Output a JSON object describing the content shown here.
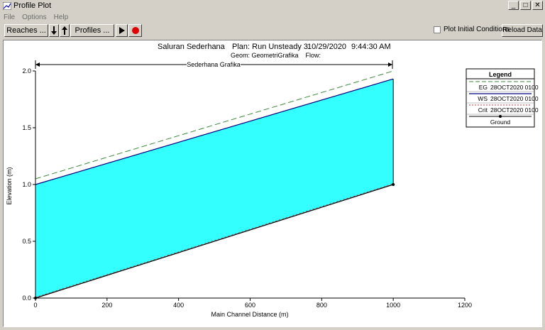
{
  "window": {
    "title": "Profile Plot",
    "min": "_",
    "max": "□",
    "close": "✕"
  },
  "menu": [
    "File",
    "Options",
    "Help"
  ],
  "toolbar": {
    "reaches": "Reaches ...",
    "profiles": "Profiles ...",
    "plot_initial_label": "Plot Initial Conditions",
    "plot_initial_checked": false,
    "reload": "Reload Data"
  },
  "plot": {
    "title_river": "Saluran Sederhana",
    "title_plan": "Plan: Run Unsteady 3",
    "title_date": "10/29/2020",
    "title_time": "9:44:30 AM",
    "geom_line": "Geom: GeometriGrafika    Flow:",
    "reach_label": "Sederhana Grafika",
    "xlabel": "Main Channel Distance (m)",
    "ylabel": "Elevation (m)"
  },
  "legend": {
    "title": "Legend",
    "items": [
      {
        "code": "EG",
        "label": "28OCT2020 0100",
        "color": "#3c8a3c"
      },
      {
        "code": "WS",
        "label": "28OCT2020 0100",
        "color": "#000080"
      },
      {
        "code": "Crit",
        "label": "28OCT2020 0100",
        "color": "#d03030"
      },
      {
        "code": "",
        "label": "Ground",
        "color": "#000000"
      }
    ]
  },
  "chart_data": {
    "type": "line",
    "xlim": [
      0,
      1200
    ],
    "ylim": [
      0,
      2.0
    ],
    "x_ticks": [
      0,
      200,
      400,
      600,
      800,
      1000,
      1200
    ],
    "y_ticks": [
      0.0,
      0.5,
      1.0,
      1.5,
      2.0
    ],
    "y_tick_labels": [
      "0.0",
      "0.5",
      "1.0",
      "1.5",
      "2.0"
    ],
    "series": [
      {
        "name": "EG 28OCT2020 0100",
        "x": [
          0,
          1000
        ],
        "y": [
          1.05,
          2.0
        ]
      },
      {
        "name": "WS 28OCT2020 0100",
        "x": [
          0,
          1000
        ],
        "y": [
          1.0,
          1.93
        ]
      },
      {
        "name": "Crit 28OCT2020 0100",
        "x": [
          0,
          1000
        ],
        "y": [
          0.0,
          1.0
        ]
      },
      {
        "name": "Ground",
        "x": [
          0,
          1000
        ],
        "y": [
          0.0,
          1.0
        ]
      }
    ],
    "water_fill": "#33ffff",
    "grid": false
  }
}
